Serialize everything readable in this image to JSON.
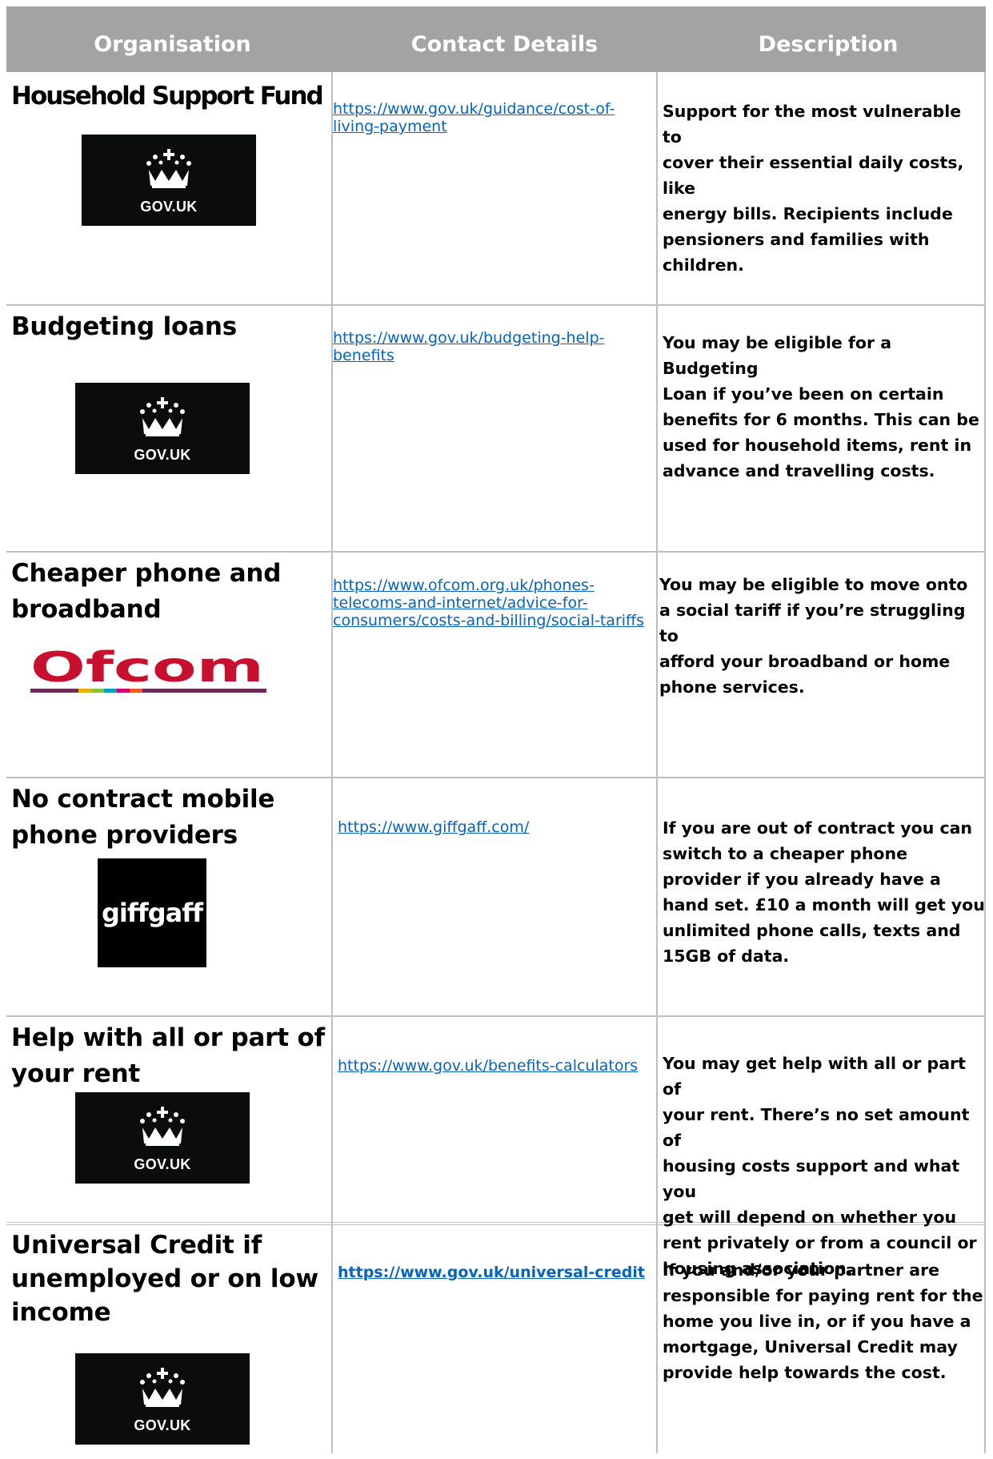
{
  "header": {
    "col_organisation": "Organisation",
    "col_contact": "Contact Details",
    "col_description": "Description"
  },
  "rows": [
    {
      "organisation": "Household Support Fund",
      "logo": "gov-uk-logo",
      "logo_text": "GOV.UK",
      "link_lines": [
        "https://www.gov.uk/guidance/cost-of-",
        "living-payment"
      ],
      "description_lines": [
        "Support for the most vulnerable to",
        "cover their essential daily costs, like",
        "energy bills. Recipients include",
        "pensioners and families with",
        "children."
      ]
    },
    {
      "organisation": "Budgeting loans",
      "logo": "gov-uk-logo",
      "logo_text": "GOV.UK",
      "link_lines": [
        "https://www.gov.uk/budgeting-help-",
        "benefits"
      ],
      "description_lines": [
        "You may be eligible for a Budgeting",
        "Loan if you’ve been on certain",
        "benefits for 6 months. This can be",
        "used for household items, rent in",
        "advance and travelling costs."
      ]
    },
    {
      "organisation_lines": [
        "Cheaper phone and",
        "broadband"
      ],
      "logo": "ofcom-logo",
      "logo_text": "Ofcom",
      "link_lines": [
        "https://www.ofcom.org.uk/phones-",
        "telecoms-and-internet/advice-for-",
        "consumers/costs-and-billing/social-tariffs"
      ],
      "description_lines": [
        "You may be eligible to move onto",
        "a social tariff if you’re struggling to",
        "afford your broadband or home",
        "phone services."
      ]
    },
    {
      "organisation_lines": [
        "No contract mobile",
        "phone providers"
      ],
      "logo": "giffgaff-logo",
      "logo_text": "giffgaff",
      "link_lines": [
        "https://www.giffgaff.com/"
      ],
      "description_lines": [
        "If you are out of contract you can",
        "switch to a cheaper phone",
        "provider if you already have a",
        "hand set. £10 a month will get you",
        "unlimited phone calls, texts and",
        "15GB of data."
      ]
    },
    {
      "organisation_lines": [
        "Help with all or part of",
        "your rent"
      ],
      "logo": "gov-uk-logo",
      "logo_text": "GOV.UK",
      "link_lines": [
        "https://www.gov.uk/benefits-calculators"
      ],
      "description_lines": [
        "You may get help with all or part of",
        "your rent.  There’s no set amount of",
        "housing costs support and what you",
        "get will depend on whether you",
        "rent privately or from a council or",
        "housing association."
      ]
    },
    {
      "organisation_lines": [
        "Universal Credit if",
        "unemployed or on low",
        "income"
      ],
      "logo": "gov-uk-logo",
      "logo_text": "GOV.UK",
      "link_lines": [
        "https://www.gov.uk/universal-credit"
      ],
      "description_lines": [
        "If you and/or your partner are",
        "responsible for paying rent for the",
        "home you live in, or if you have a",
        "mortgage, Universal Credit may",
        "provide help towards the cost."
      ]
    }
  ]
}
